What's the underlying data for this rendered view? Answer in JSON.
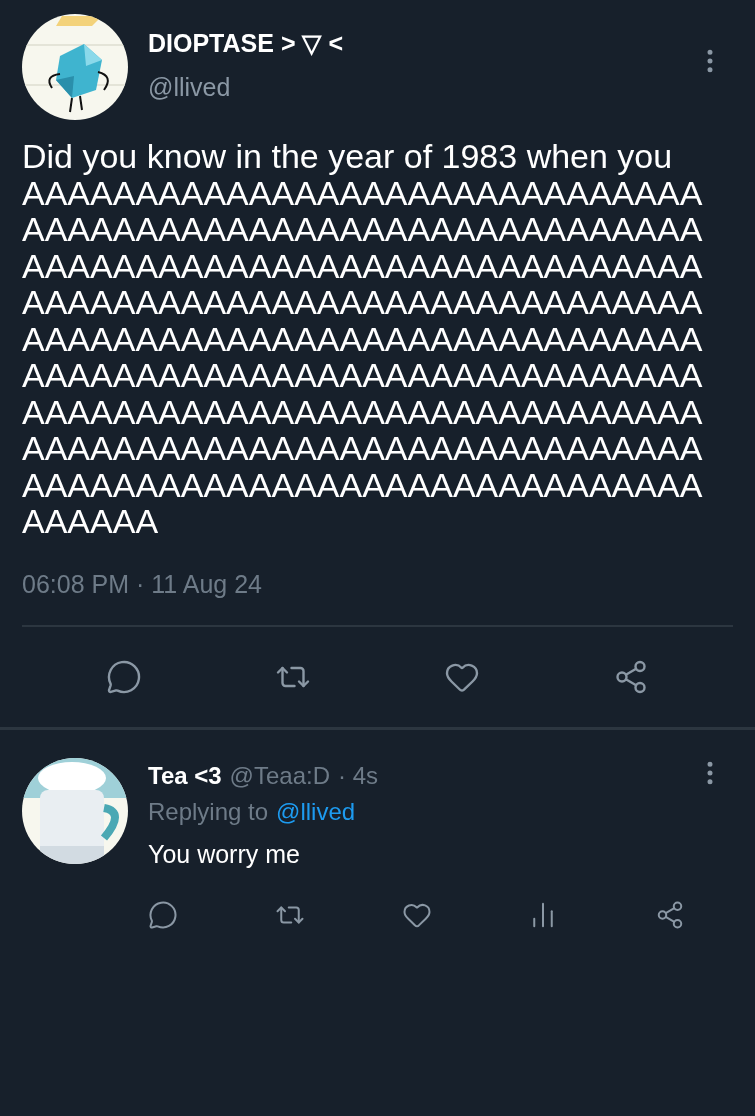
{
  "tweet": {
    "author": {
      "name": "DIOPTASE > ▽ <",
      "handle": "@llived"
    },
    "text": "Did you know in the year of 1983 when you AAAAAAAAAAAAAAAAAAAAAAAAAAAAAAAAAAAAAAAAAAAAAAAAAAAAAAAAAAAAAAAAAAAAAAAAAAAAAAAAAAAAAAAAAAAAAAAAAAAAAAAAAAAAAAAAAAAAAAAAAAAAAAAAAAAAAAAAAAAAAAAAAAAAAAAAAAAAAAAAAAAAAAAAAAAAAAAAAAAAAAAAAAAAAAAAAAAAAAAAAAAAAAAAAAAAAAAAAAAAAAAAAAAAAAAAAAAAAAAAAAAAAAAAAAAAAAAAAAAAAAAAAAAAAAAAAAAA",
    "timestamp": "06:08 PM · 11 Aug 24",
    "actions": [
      {
        "kind": "reply"
      },
      {
        "kind": "retweet"
      },
      {
        "kind": "like"
      },
      {
        "kind": "share"
      }
    ]
  },
  "reply": {
    "author": {
      "name": "Tea <3",
      "handle": "@Teaa:D",
      "time": "· 4s"
    },
    "replying_label": "Replying to",
    "replying_to": "@llived",
    "text": "You worry me",
    "actions": [
      {
        "kind": "reply"
      },
      {
        "kind": "retweet"
      },
      {
        "kind": "like"
      },
      {
        "kind": "stats"
      },
      {
        "kind": "share"
      }
    ]
  }
}
